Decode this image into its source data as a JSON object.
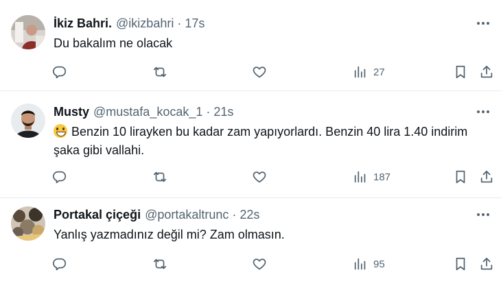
{
  "tweets": [
    {
      "name": "İkiz Bahri.",
      "handle": "@ikizbahri",
      "separator": "·",
      "time": "17s",
      "text": "Du bakalım ne olacak",
      "views": "27"
    },
    {
      "name": "Musty",
      "handle": "@mustafa_kocak_1",
      "separator": "·",
      "time": "21s",
      "emoji": "grinning-face",
      "text": "Benzin 10 lirayken bu kadar zam yapıyorlardı. Benzin 40 lira 1.40 indirim şaka gibi vallahi.",
      "views": "187"
    },
    {
      "name": "Portakal çiçeği",
      "handle": "@portakaltrunc",
      "separator": "·",
      "time": "22s",
      "text": "Yanlış yazmadınız değil mi? Zam olmasın.",
      "views": "95"
    }
  ],
  "icons": {
    "reply": "reply-icon",
    "retweet": "retweet-icon",
    "like": "heart-icon",
    "views": "views-chart-icon",
    "bookmark": "bookmark-icon",
    "share": "share-icon",
    "more": "more-icon"
  },
  "colors": {
    "text": "#0f1419",
    "secondary": "#536471",
    "divider": "#e6ecf0"
  }
}
